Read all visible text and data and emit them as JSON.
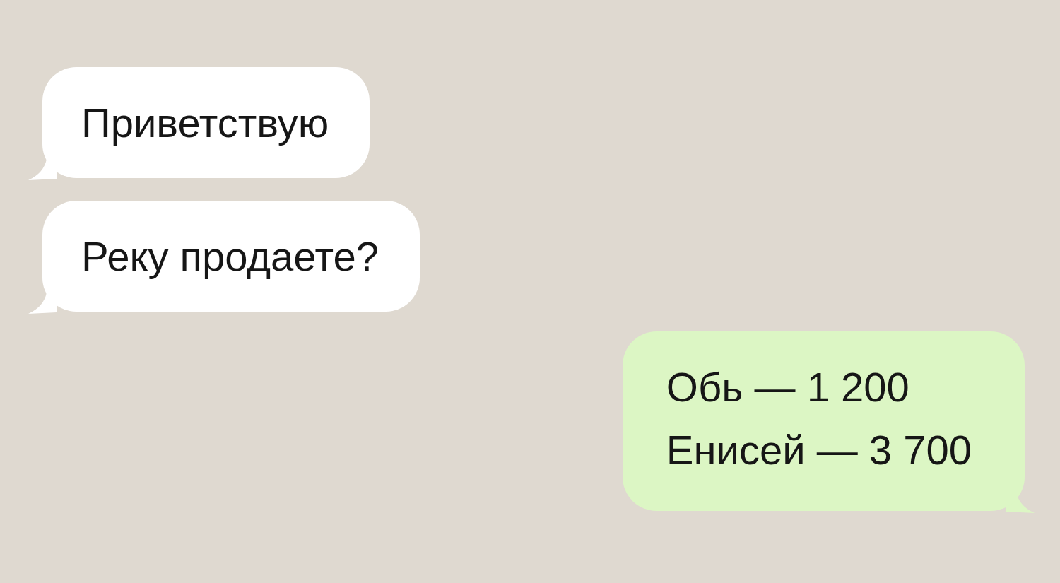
{
  "messages": [
    {
      "kind": "incoming",
      "lines": [
        "Приветствую"
      ]
    },
    {
      "kind": "incoming",
      "lines": [
        "Реку продаете?"
      ]
    },
    {
      "kind": "outgoing",
      "lines": [
        "Обь — 1 200",
        "Енисей — 3 700"
      ]
    }
  ]
}
